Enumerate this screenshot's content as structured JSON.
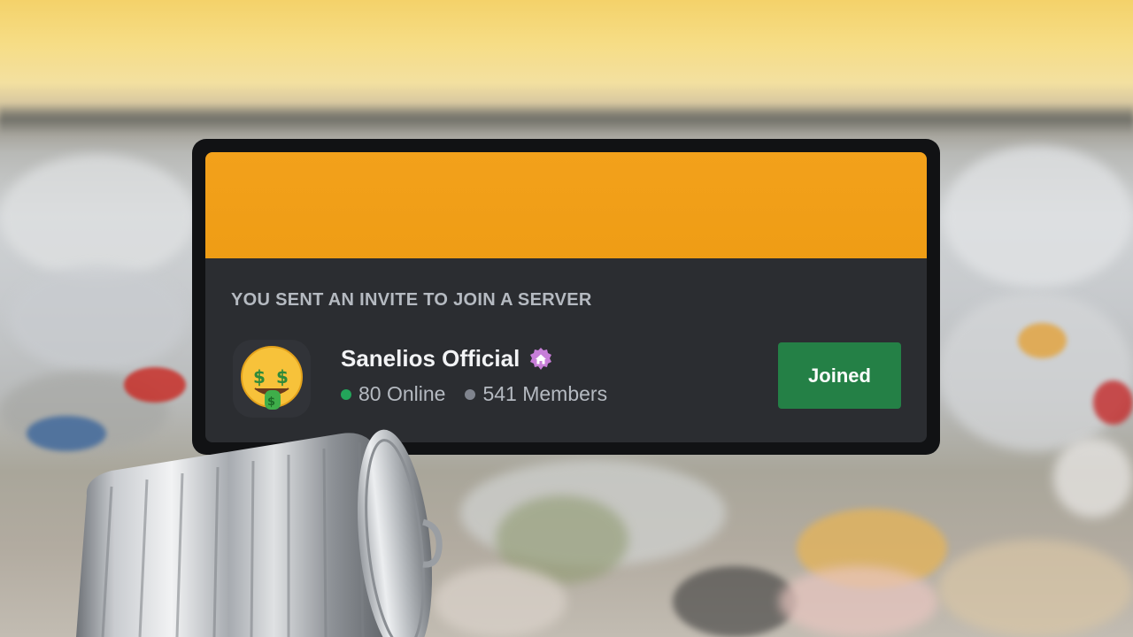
{
  "invite": {
    "header": "YOU SENT AN INVITE TO JOIN A SERVER",
    "server_name": "Sanelios Official",
    "server_icon": "money-mouth-face-emoji",
    "badge_icon": "community-home-icon",
    "online_count": "80 Online",
    "member_count": "541 Members",
    "join_button_label": "Joined",
    "colors": {
      "banner": "#f3a11b",
      "body": "#2b2d31",
      "button": "#248046",
      "online_dot": "#23a55a",
      "members_dot": "#80848e"
    }
  },
  "background": {
    "scene": "landfill-at-sunset",
    "overlay_object": "metal-trash-can"
  }
}
